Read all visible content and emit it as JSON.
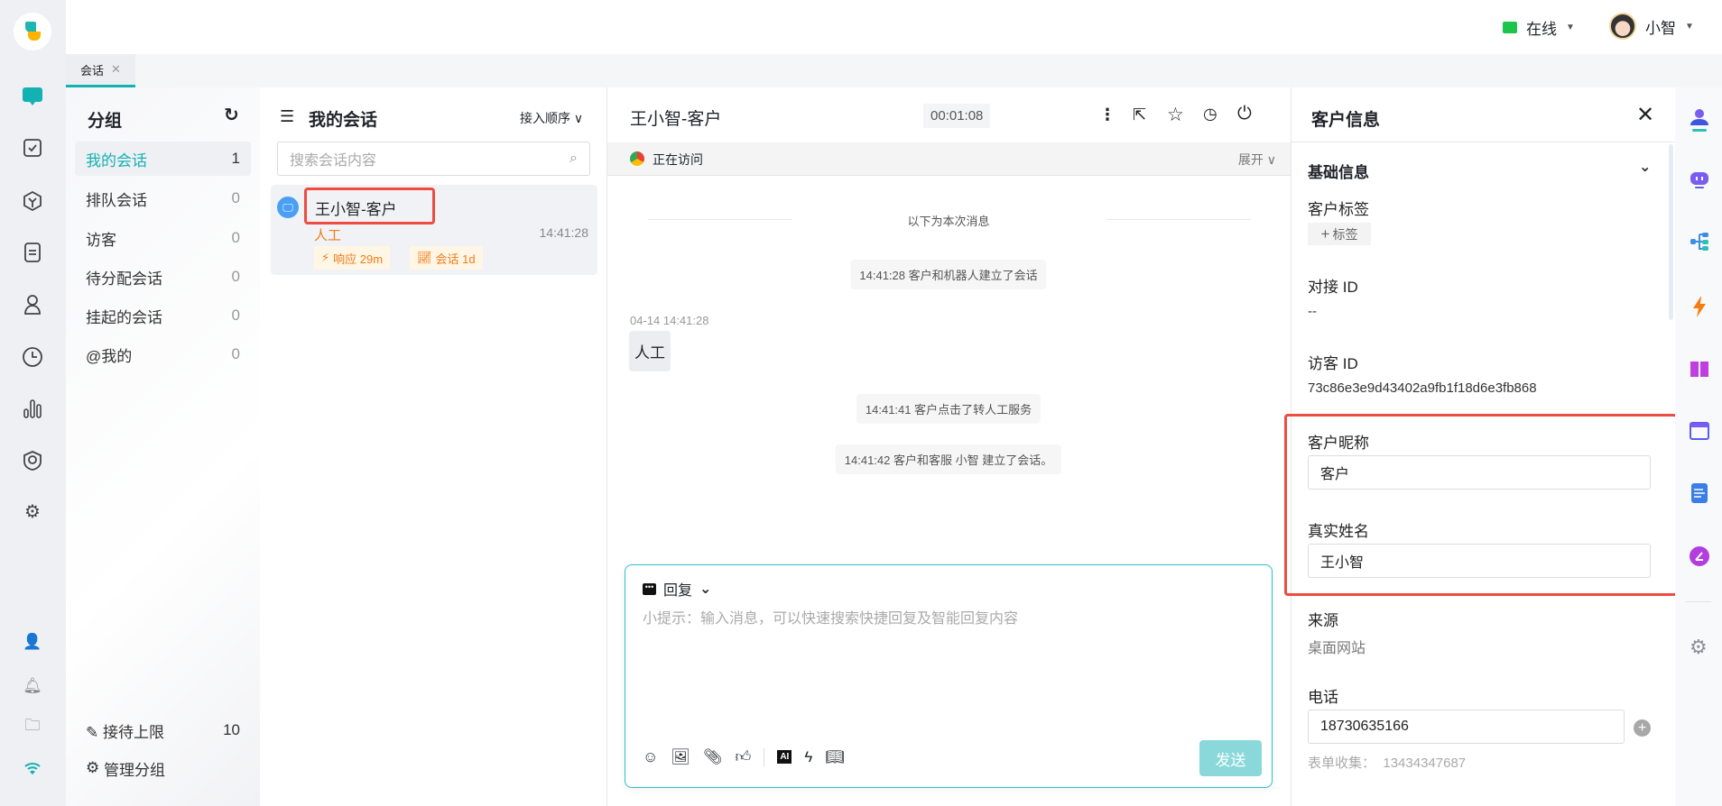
{
  "topbar": {
    "status": "在线",
    "user": "小智"
  },
  "tabs": [
    {
      "label": "会话"
    }
  ],
  "groups": {
    "title": "分组",
    "items": [
      {
        "label": "我的会话",
        "count": "1"
      },
      {
        "label": "排队会话",
        "count": "0"
      },
      {
        "label": "访客",
        "count": "0"
      },
      {
        "label": "待分配会话",
        "count": "0"
      },
      {
        "label": "挂起的会话",
        "count": "0"
      },
      {
        "label": "@我的",
        "count": "0"
      }
    ],
    "limit_label": "接待上限",
    "limit_value": "10",
    "manage_label": "管理分组"
  },
  "list": {
    "title": "我的会话",
    "sort": "接入顺序",
    "search_placeholder": "搜索会话内容",
    "items": [
      {
        "name": "王小智-客户",
        "type": "人工",
        "time": "14:41:28",
        "badge1": "响应 29m",
        "badge2": "会话 1d"
      }
    ]
  },
  "chat": {
    "title": "王小智-客户",
    "timer": "00:01:08",
    "visiting": "正在访问",
    "expand": "展开",
    "divider": "以下为本次消息",
    "messages": [
      {
        "kind": "system",
        "text": "14:41:28 客户和机器人建立了会话"
      },
      {
        "kind": "customer",
        "time": "04-14 14:41:28",
        "text": "人工"
      },
      {
        "kind": "system",
        "text": "14:41:41 客户点击了转人工服务"
      },
      {
        "kind": "system",
        "text": "14:41:42 客户和客服 小智 建立了会话。"
      }
    ],
    "composer": {
      "mode": "回复",
      "placeholder": "小提示：输入消息，可以快速搜索快捷回复及智能回复内容",
      "send": "发送",
      "ai": "AI"
    }
  },
  "info": {
    "title": "客户信息",
    "section": "基础信息",
    "tags_label": "客户标签",
    "add_tag": "标签",
    "dock_id_label": "对接 ID",
    "dock_id": "--",
    "visitor_id_label": "访客 ID",
    "visitor_id": "73c86e3e9d43402a9fb1f18d6e3fb868",
    "nickname_label": "客户昵称",
    "nickname": "客户",
    "realname_label": "真实姓名",
    "realname": "王小智",
    "source_label": "来源",
    "source": "桌面网站",
    "phone_label": "电话",
    "phone": "18730635166",
    "form_label": "表单收集：",
    "form_value": "13434347687"
  },
  "colors": {
    "accent": "#14b1b3",
    "highlight": "#ee4c43",
    "orange": "#f07c19"
  }
}
